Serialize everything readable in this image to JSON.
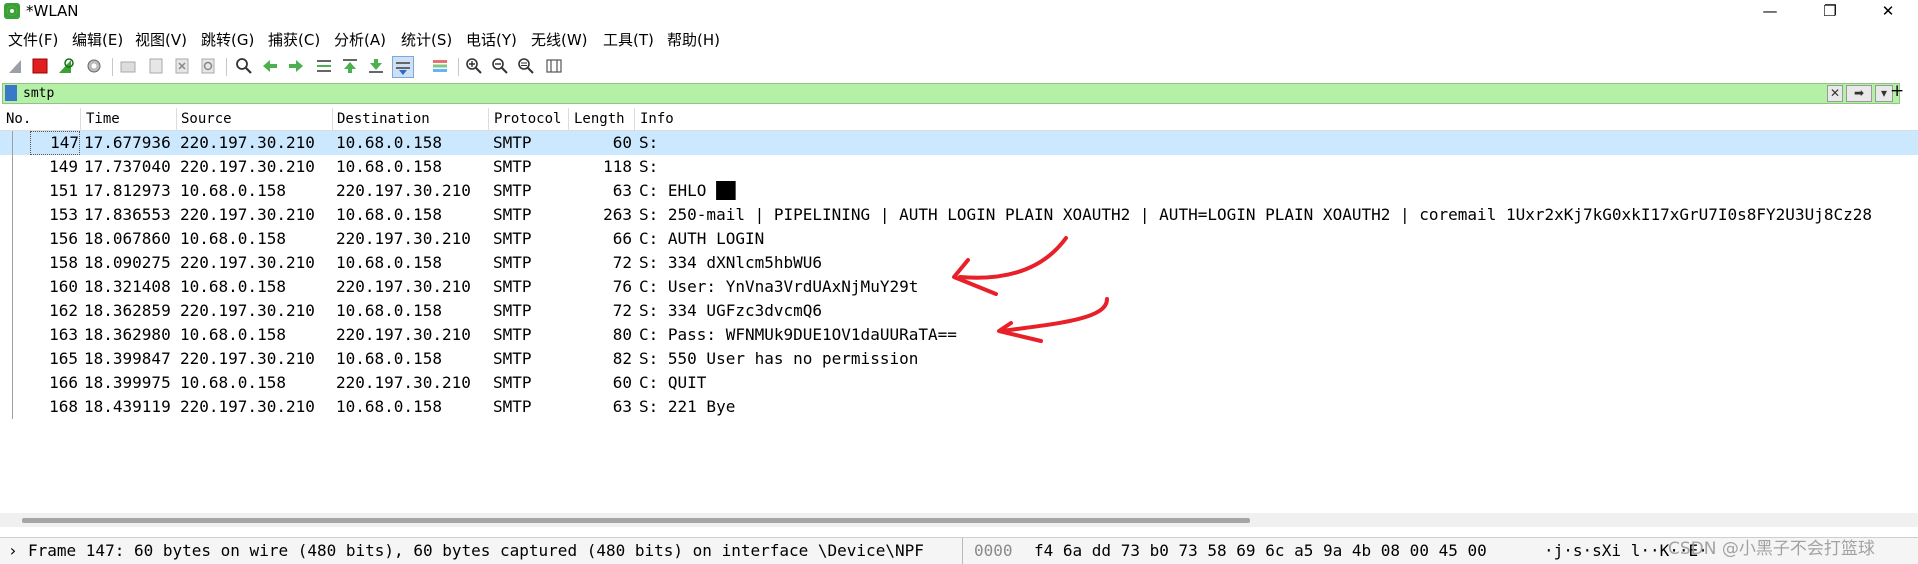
{
  "window": {
    "title": "*WLAN",
    "controls": {
      "minimize": "—",
      "restore": "❐",
      "close": "✕"
    }
  },
  "menu": [
    "文件(F)",
    "编辑(E)",
    "视图(V)",
    "跳转(G)",
    "捕获(C)",
    "分析(A)",
    "统计(S)",
    "电话(Y)",
    "无线(W)",
    "工具(T)",
    "帮助(H)"
  ],
  "toolbar_icons": [
    "shark-fin-start-icon",
    "stop-capture-icon",
    "restart-capture-icon",
    "capture-options-icon",
    "open-file-icon",
    "save-file-icon",
    "close-file-icon",
    "reload-icon",
    "find-packet-icon",
    "go-back-icon",
    "go-forward-icon",
    "go-to-packet-icon",
    "first-packet-icon",
    "last-packet-icon",
    "autoscroll-icon",
    "colorize-icon",
    "zoom-in-icon",
    "zoom-out-icon",
    "zoom-normal-icon",
    "resize-columns-icon"
  ],
  "filter": {
    "value": "smtp",
    "clear": "✕",
    "apply": "➡",
    "dropdown": "▾",
    "add": "+"
  },
  "columns": [
    "No.",
    "Time",
    "Source",
    "Destination",
    "Protocol",
    "Length",
    "Info"
  ],
  "packets": [
    {
      "no": "147",
      "time": "17.677936",
      "source": "220.197.30.210",
      "destination": "10.68.0.158",
      "protocol": "SMTP",
      "length": "60",
      "info": "S:"
    },
    {
      "no": "149",
      "time": "17.737040",
      "source": "220.197.30.210",
      "destination": "10.68.0.158",
      "protocol": "SMTP",
      "length": "118",
      "info": "S:"
    },
    {
      "no": "151",
      "time": "17.812973",
      "source": "10.68.0.158",
      "destination": "220.197.30.210",
      "protocol": "SMTP",
      "length": "63",
      "info": "C: EHLO ██"
    },
    {
      "no": "153",
      "time": "17.836553",
      "source": "220.197.30.210",
      "destination": "10.68.0.158",
      "protocol": "SMTP",
      "length": "263",
      "info": "S: 250-mail | PIPELINING | AUTH LOGIN PLAIN XOAUTH2 | AUTH=LOGIN PLAIN XOAUTH2 | coremail 1Uxr2xKj7kG0xkI17xGrU7I0s8FY2U3Uj8Cz28"
    },
    {
      "no": "156",
      "time": "18.067860",
      "source": "10.68.0.158",
      "destination": "220.197.30.210",
      "protocol": "SMTP",
      "length": "66",
      "info": "C: AUTH LOGIN"
    },
    {
      "no": "158",
      "time": "18.090275",
      "source": "220.197.30.210",
      "destination": "10.68.0.158",
      "protocol": "SMTP",
      "length": "72",
      "info": "S: 334 dXNlcm5hbWU6"
    },
    {
      "no": "160",
      "time": "18.321408",
      "source": "10.68.0.158",
      "destination": "220.197.30.210",
      "protocol": "SMTP",
      "length": "76",
      "info": "C: User: YnVna3VrdUAxNjMuY29t"
    },
    {
      "no": "162",
      "time": "18.362859",
      "source": "220.197.30.210",
      "destination": "10.68.0.158",
      "protocol": "SMTP",
      "length": "72",
      "info": "S: 334 UGFzc3dvcmQ6"
    },
    {
      "no": "163",
      "time": "18.362980",
      "source": "10.68.0.158",
      "destination": "220.197.30.210",
      "protocol": "SMTP",
      "length": "80",
      "info": "C: Pass: WFNMUk9DUE1OV1daUURaTA=="
    },
    {
      "no": "165",
      "time": "18.399847",
      "source": "220.197.30.210",
      "destination": "10.68.0.158",
      "protocol": "SMTP",
      "length": "82",
      "info": "S: 550 User has no permission"
    },
    {
      "no": "166",
      "time": "18.399975",
      "source": "10.68.0.158",
      "destination": "220.197.30.210",
      "protocol": "SMTP",
      "length": "60",
      "info": "C: QUIT"
    },
    {
      "no": "168",
      "time": "18.439119",
      "source": "220.197.30.210",
      "destination": "10.68.0.158",
      "protocol": "SMTP",
      "length": "63",
      "info": "S: 221 Bye"
    }
  ],
  "status": {
    "expander": "›",
    "frame": "Frame 147: 60 bytes on wire (480 bits), 60 bytes captured (480 bits) on interface \\Device\\NPF",
    "hex_offset": "0000",
    "hex_bytes": "f4 6a dd 73 b0 73 58 69  6c a5 9a 4b 08 00 45 00",
    "hex_ascii": "·j·s·sXi l··K··E·"
  },
  "watermark": "CSDN @小黑子不会打篮球",
  "colors": {
    "filter_bg": "#b4f1a6",
    "selected_row": "#cce8ff",
    "annotation_red": "#e8202a"
  }
}
